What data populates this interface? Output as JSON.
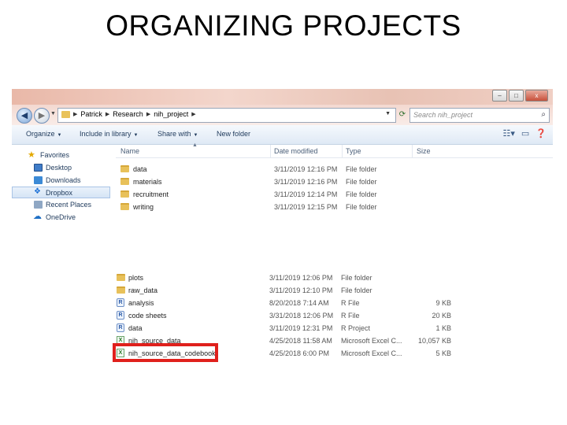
{
  "slide": {
    "title": "ORGANIZING PROJECTS"
  },
  "window": {
    "buttons": {
      "minimize": "–",
      "maximize": "□",
      "close": "x"
    }
  },
  "address": {
    "crumbs": [
      "Patrick",
      "Research",
      "nih_project"
    ],
    "search_placeholder": "Search nih_project"
  },
  "toolbar": {
    "organize": "Organize",
    "include_in_library": "Include in library",
    "share_with": "Share with",
    "new_folder": "New folder"
  },
  "nav": {
    "items": [
      {
        "label": "Favorites",
        "icon": "star-icon"
      },
      {
        "label": "Desktop",
        "icon": "desktop-icon"
      },
      {
        "label": "Downloads",
        "icon": "downloads-icon"
      },
      {
        "label": "Dropbox",
        "icon": "dropbox-icon",
        "selected": true
      },
      {
        "label": "Recent Places",
        "icon": "recent-places-icon"
      },
      {
        "label": "OneDrive",
        "icon": "cloud-icon"
      }
    ]
  },
  "columns": {
    "name": "Name",
    "date": "Date modified",
    "type": "Type",
    "size": "Size"
  },
  "files": [
    {
      "name": "data",
      "date": "3/11/2019 12:16 PM",
      "type": "File folder"
    },
    {
      "name": "materials",
      "date": "3/11/2019 12:16 PM",
      "type": "File folder"
    },
    {
      "name": "recruitment",
      "date": "3/11/2019 12:14 PM",
      "type": "File folder"
    },
    {
      "name": "writing",
      "date": "3/11/2019 12:15 PM",
      "type": "File folder"
    }
  ],
  "data_folder": {
    "files": [
      {
        "name": "plots",
        "date": "3/11/2019 12:06 PM",
        "type": "File folder",
        "size": "",
        "icon": "folder-icon"
      },
      {
        "name": "raw_data",
        "date": "3/11/2019 12:10 PM",
        "type": "File folder",
        "size": "",
        "icon": "folder-icon"
      },
      {
        "name": "analysis",
        "date": "8/20/2018 7:14 AM",
        "type": "R File",
        "size": "9 KB",
        "icon": "r-file-icon"
      },
      {
        "name": "code sheets",
        "date": "3/31/2018 12:06 PM",
        "type": "R File",
        "size": "20 KB",
        "icon": "r-file-icon"
      },
      {
        "name": "data",
        "date": "3/11/2019 12:31 PM",
        "type": "R Project",
        "size": "1 KB",
        "icon": "r-project-icon"
      },
      {
        "name": "nih_source_data",
        "date": "4/25/2018 11:58 AM",
        "type": "Microsoft Excel C...",
        "size": "10,057 KB",
        "icon": "excel-csv-icon"
      },
      {
        "name": "nih_source_data_codebook",
        "date": "4/25/2018 6:00 PM",
        "type": "Microsoft Excel C...",
        "size": "5 KB",
        "icon": "excel-csv-icon"
      }
    ]
  }
}
